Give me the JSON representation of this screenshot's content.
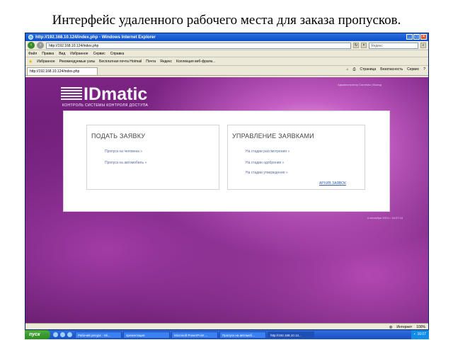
{
  "slide_title": "Интерфейс удаленного рабочего места для заказа пропусков.",
  "browser": {
    "window_title": "http://192.168.10.124/index.php - Windows Internet Explorer",
    "address": "http://192.168.10.124/index.php",
    "search_placeholder": "Яндекс",
    "menu": [
      "Файл",
      "Правка",
      "Вид",
      "Избранное",
      "Сервис",
      "Справка"
    ],
    "favorites_label": "Избранное",
    "favorites_items": [
      "Рекомендуемые узлы",
      "Бесплатная почта Hotmail",
      "Почта",
      "Яндекс",
      "Коллекция веб-фрагм..."
    ],
    "tab_label": "http://192.168.10.124/index.php",
    "command_items": [
      "Страница",
      "Безопасность",
      "Сервис"
    ],
    "status_text": "Интернет",
    "zoom": "100%"
  },
  "site": {
    "logo_text": "IDmatic",
    "logo_subtitle": "КОНТРОЛЬ СИСТЕМЫ КОНТРОЛЯ ДОСТУПА",
    "top_link": "Администратор Системы | Выход",
    "footer_text": "4 сентября 2013 г. 16:07:10",
    "submit_box": {
      "title": "ПОДАТЬ ЗАЯВКУ",
      "links": [
        "Пропуск на человека  »",
        "Пропуск на автомобиль  »"
      ]
    },
    "manage_box": {
      "title": "УПРАВЛЕНИЕ ЗАЯВКАМИ",
      "links": [
        "На стадии рассмотрения  »",
        "На стадии одобрения  »",
        "На стадии утверждения  »"
      ],
      "archive_link": "АРХИВ ЗАЯВОК"
    }
  },
  "taskbar": {
    "start_label": "пуск",
    "items": [
      "Рабочий ресурс - Mi...",
      "презентация",
      "Microsoft PowerPoint ...",
      "Пропуск на автомоб...",
      "http://192.168.10.12..."
    ],
    "clock": "16:07"
  }
}
